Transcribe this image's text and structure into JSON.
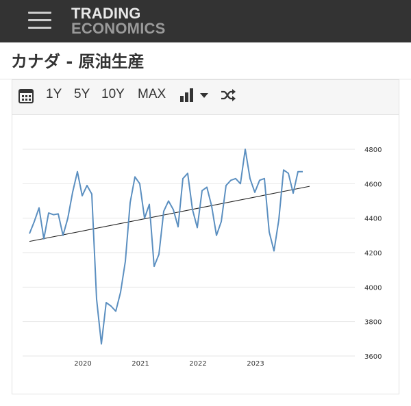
{
  "header": {
    "logo_line1": "TRADING",
    "logo_line2": "ECONOMICS"
  },
  "page": {
    "title": "カナダ - 原油生産"
  },
  "toolbar": {
    "btn_1y": "1Y",
    "btn_5y": "5Y",
    "btn_10y": "10Y",
    "btn_max": "MAX"
  },
  "colors": {
    "series": "#5b8fc0",
    "trend": "#222222",
    "grid": "#e6e6e6",
    "topbar": "#333333"
  },
  "chart_data": {
    "type": "line",
    "title": "",
    "xlabel": "",
    "ylabel": "",
    "ylim": [
      3600,
      4800
    ],
    "y_ticks": [
      "3600",
      "3800",
      "4000",
      "4200",
      "4400",
      "4600",
      "4800"
    ],
    "x_ticks": [
      "2020",
      "2021",
      "2022",
      "2023"
    ],
    "y_axis_side": "right",
    "grid": true,
    "legend": "none",
    "series": [
      {
        "x": [
          "2019-01",
          "2019-02",
          "2019-03",
          "2019-04",
          "2019-05",
          "2019-06",
          "2019-07",
          "2019-08",
          "2019-09",
          "2019-10",
          "2019-11",
          "2019-12",
          "2020-01",
          "2020-02",
          "2020-03",
          "2020-04",
          "2020-05",
          "2020-06",
          "2020-07",
          "2020-08",
          "2020-09",
          "2020-10",
          "2020-11",
          "2020-12",
          "2021-01",
          "2021-02",
          "2021-03",
          "2021-04",
          "2021-05",
          "2021-06",
          "2021-07",
          "2021-08",
          "2021-09",
          "2021-10",
          "2021-11",
          "2021-12",
          "2022-01",
          "2022-02",
          "2022-03",
          "2022-04",
          "2022-05",
          "2022-06",
          "2022-07",
          "2022-08",
          "2022-09",
          "2022-10",
          "2022-11",
          "2022-12",
          "2023-01",
          "2023-02",
          "2023-03",
          "2023-04",
          "2023-05",
          "2023-06",
          "2023-07",
          "2023-08",
          "2023-09",
          "2023-10"
        ],
        "values": [
          4310,
          4380,
          4460,
          4280,
          4430,
          4420,
          4425,
          4300,
          4400,
          4550,
          4670,
          4530,
          4590,
          4540,
          3930,
          3670,
          3910,
          3890,
          3860,
          3970,
          4150,
          4490,
          4640,
          4600,
          4400,
          4480,
          4120,
          4190,
          4440,
          4500,
          4450,
          4350,
          4630,
          4660,
          4450,
          4345,
          4560,
          4580,
          4470,
          4300,
          4380,
          4590,
          4620,
          4630,
          4600,
          4800,
          4630,
          4550,
          4620,
          4630,
          4320,
          4210,
          4390,
          4680,
          4660,
          4545,
          4670,
          4670
        ]
      }
    ],
    "trend": {
      "start": [
        "2019-01",
        4265
      ],
      "end": [
        "2023-10",
        4585
      ]
    }
  }
}
